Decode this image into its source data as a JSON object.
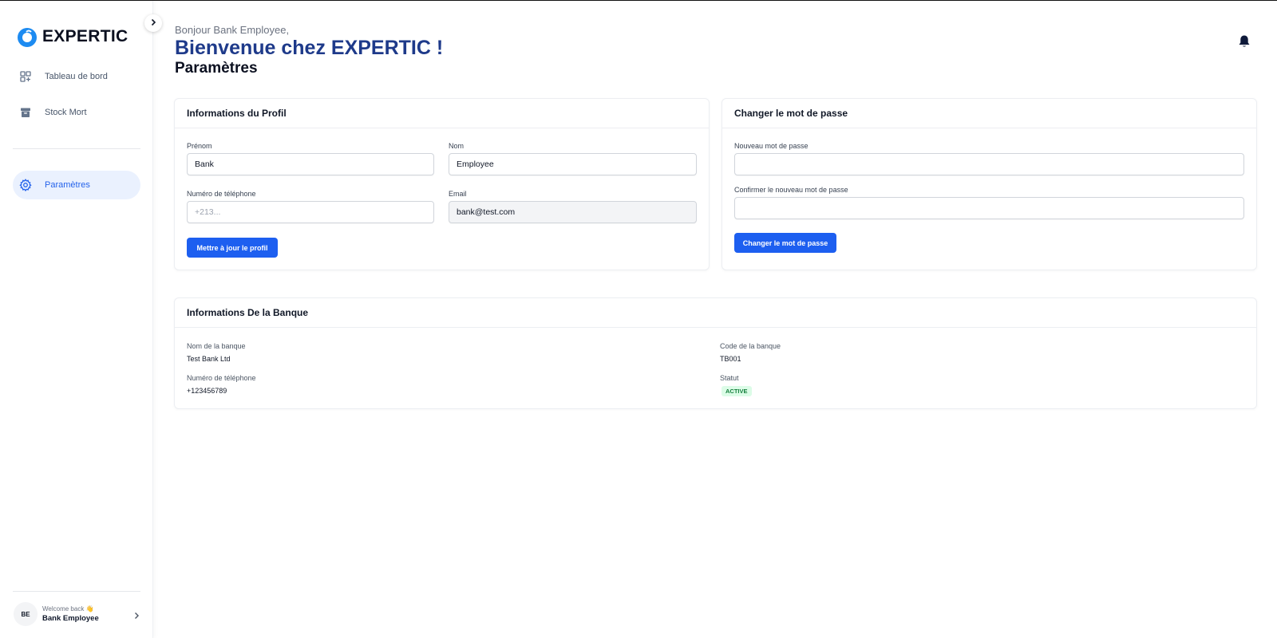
{
  "app": {
    "logo_text": "EXPERTIC",
    "brand_color": "#1d8bf1",
    "accent_color": "#1d5ff0"
  },
  "sidebar": {
    "items": [
      {
        "label": "Tableau de bord",
        "icon": "dashboard-grid-icon",
        "active": false
      },
      {
        "label": "Stock Mort",
        "icon": "archive-box-icon",
        "active": false
      },
      {
        "label": "Paramètres",
        "icon": "gear-icon",
        "active": true
      }
    ],
    "user": {
      "initials": "BE",
      "welcome": "Welcome back 👋",
      "name": "Bank Employee"
    }
  },
  "header": {
    "greeting": "Bonjour Bank Employee,",
    "welcome_title": "Bienvenue chez EXPERTIC !",
    "page_title": "Paramètres"
  },
  "profile": {
    "title": "Informations du Profil",
    "first_name_label": "Prénom",
    "first_name_value": "Bank",
    "last_name_label": "Nom",
    "last_name_value": "Employee",
    "phone_label": "Numéro de téléphone",
    "phone_placeholder": "+213...",
    "email_label": "Email",
    "email_value": "bank@test.com",
    "update_button": "Mettre à jour le profil"
  },
  "password": {
    "title": "Changer le mot de passe",
    "new_label": "Nouveau mot de passe",
    "new_value": "",
    "confirm_label": "Confirmer le nouveau mot de passe",
    "confirm_value": "",
    "change_button": "Changer le mot de passe"
  },
  "bank": {
    "title": "Informations De la Banque",
    "name_label": "Nom de la banque",
    "name_value": "Test Bank Ltd",
    "code_label": "Code de la banque",
    "code_value": "TB001",
    "phone_label": "Numéro de téléphone",
    "phone_value": "+123456789",
    "status_label": "Statut",
    "status_value": "ACTIVE",
    "status_color": "#15803d"
  }
}
